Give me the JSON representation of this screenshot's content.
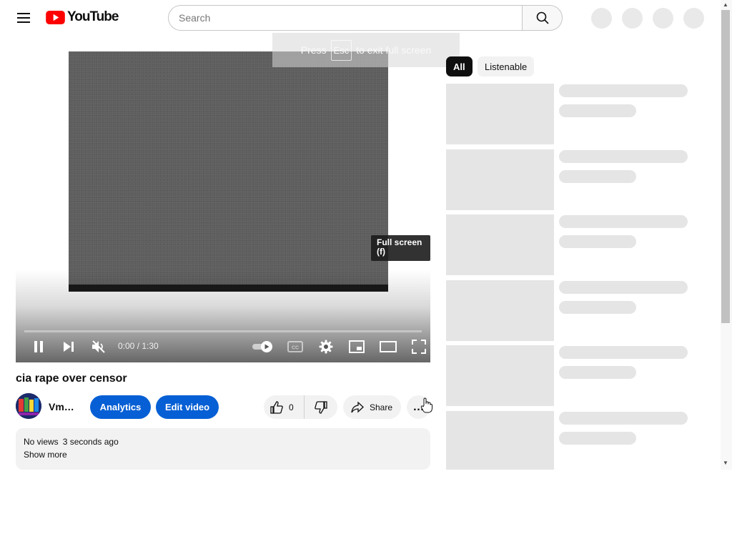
{
  "header": {
    "logo_text": "YouTube",
    "search_placeholder": "Search"
  },
  "toast": {
    "prefix": "Press",
    "key": "Esc",
    "suffix": "to exit full screen"
  },
  "player": {
    "time": "0:00 / 1:30",
    "progress": 0.0,
    "fullscreen_tooltip_line1": "Full screen",
    "fullscreen_tooltip_line2": "(f)"
  },
  "video": {
    "title": "cia rape over censor",
    "channel": "Vm…",
    "analytics_label": "Analytics",
    "edit_label": "Edit video",
    "likes": "0",
    "share_label": "Share",
    "more_label": "…",
    "views": "No views",
    "uploaded": "3 seconds ago",
    "show_more": "Show more"
  },
  "chips": [
    "All",
    "Listenable"
  ],
  "recommendations_placeholder_count": 6,
  "colors": {
    "brand_red": "#ff0000",
    "button_blue": "#065fd4",
    "chip_active": "#0f0f0f",
    "skeleton": "#e5e5e5"
  },
  "icons": [
    "menu-icon",
    "youtube-logo-icon",
    "search-icon",
    "pause-icon",
    "next-icon",
    "mute-icon",
    "autoplay-toggle-icon",
    "captions-icon",
    "settings-icon",
    "miniplayer-icon",
    "theater-icon",
    "fullscreen-icon",
    "like-icon",
    "dislike-icon",
    "share-icon",
    "more-icon",
    "cursor-hand-icon"
  ]
}
